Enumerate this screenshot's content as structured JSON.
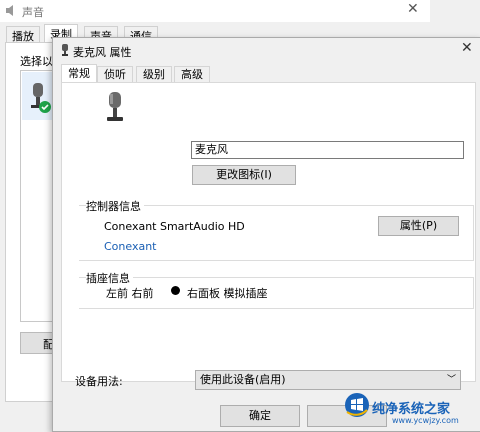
{
  "back_window": {
    "title": "声音",
    "tabs": [
      "播放",
      "录制",
      "声音",
      "通信"
    ],
    "select_label": "选择以",
    "config_label": "配"
  },
  "dialog": {
    "title": "麦克风 属性",
    "tabs": [
      "常规",
      "侦听",
      "级别",
      "高级"
    ],
    "device_name_value": "麦克风",
    "change_icon_label": "更改图标(I)",
    "controller": {
      "legend": "控制器信息",
      "name": "Conexant SmartAudio HD",
      "link": "Conexant",
      "properties_label": "属性(P)"
    },
    "jack": {
      "legend": "插座信息",
      "location": "左前 右前",
      "description": "右面板 模拟插座"
    },
    "usage": {
      "label": "设备用法:",
      "selected": "使用此设备(启用)"
    },
    "ok_label": "确定",
    "cancel_label": ""
  },
  "watermark": {
    "text": "纯净系统之家",
    "url": "www.ycwjzy.com"
  },
  "colors": {
    "accent_link": "#1a5fb4",
    "check_green": "#1fa34a",
    "watermark_blue": "#1a63b8"
  }
}
